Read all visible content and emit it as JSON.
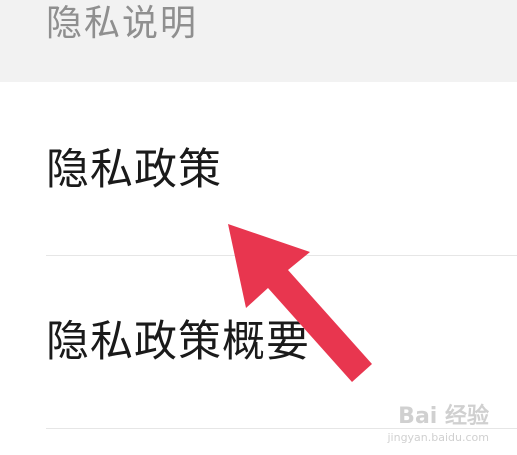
{
  "section": {
    "title": "隐私说明"
  },
  "items": [
    {
      "label": "隐私政策"
    },
    {
      "label": "隐私政策概要"
    }
  ],
  "annotation": {
    "arrow_color": "#e8364f",
    "icon": "arrow-pointer-icon"
  },
  "watermark": {
    "logo": "Bai 经验",
    "url": "jingyan.baidu.com"
  },
  "colors": {
    "header_bg": "#f2f2f2",
    "title_text": "#8f8f8f",
    "item_text": "#1a1a1a",
    "divider": "#e6e6e6"
  }
}
